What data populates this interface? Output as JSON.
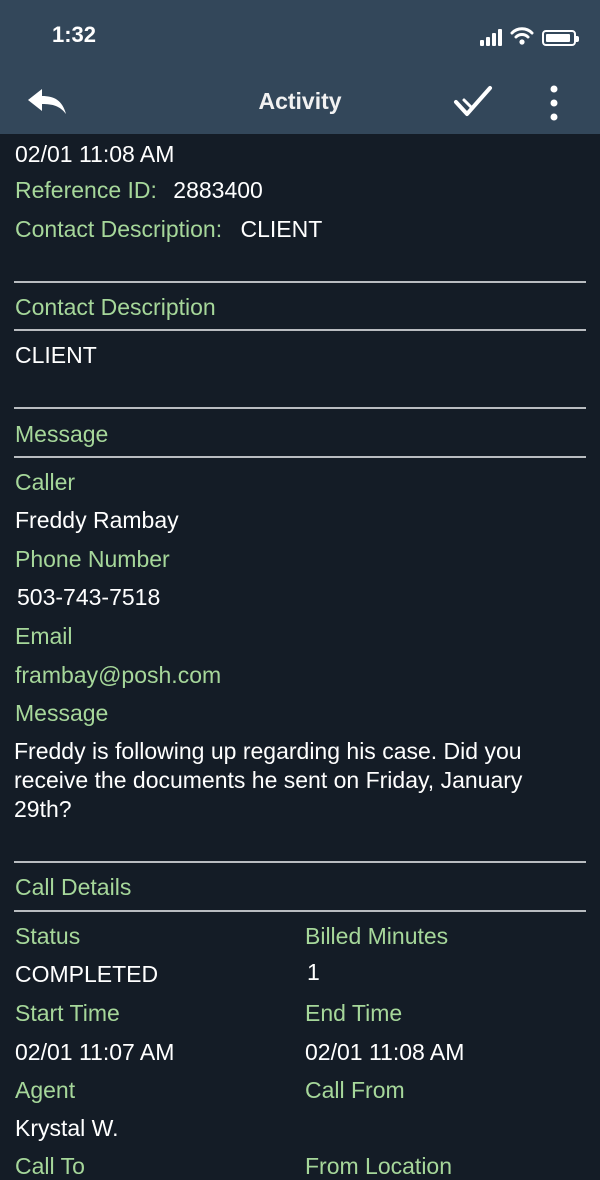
{
  "status_bar": {
    "time": "1:32"
  },
  "nav": {
    "title": "Activity",
    "back_icon": "back-arrow-icon",
    "check_icon": "checkmark-icon",
    "more_icon": "more-vertical-icon"
  },
  "header": {
    "datetime": "02/01 11:08 AM",
    "reference_label": "Reference ID:",
    "reference_value": "2883400",
    "contact_label": "Contact Description:",
    "contact_value": "CLIENT"
  },
  "contact_section": {
    "title": "Contact Description",
    "value": "CLIENT"
  },
  "message_section": {
    "title": "Message",
    "caller_label": "Caller",
    "caller_value": "Freddy Rambay",
    "phone_label": "Phone Number",
    "phone_value": "503-743-7518",
    "email_label": "Email",
    "email_value": "frambay@posh.com",
    "message_label": "Message",
    "message_value": "Freddy is following up regarding his case. Did you receive the documents he sent on Friday, January 29th?"
  },
  "call_details": {
    "title": "Call Details",
    "status_label": "Status",
    "status_value": "COMPLETED",
    "billed_label": "Billed Minutes",
    "billed_value": "1",
    "start_label": "Start Time",
    "start_value": "02/01 11:07 AM",
    "end_label": "End Time",
    "end_value": "02/01 11:08 AM",
    "agent_label": "Agent",
    "agent_value": "Krystal W.",
    "call_from_label": "Call From",
    "call_to_label": "Call To",
    "from_location_label": "From Location"
  },
  "colors": {
    "background": "#141c26",
    "header": "#33475a",
    "label": "#a6d79a",
    "divider": "#b9bcc0"
  }
}
